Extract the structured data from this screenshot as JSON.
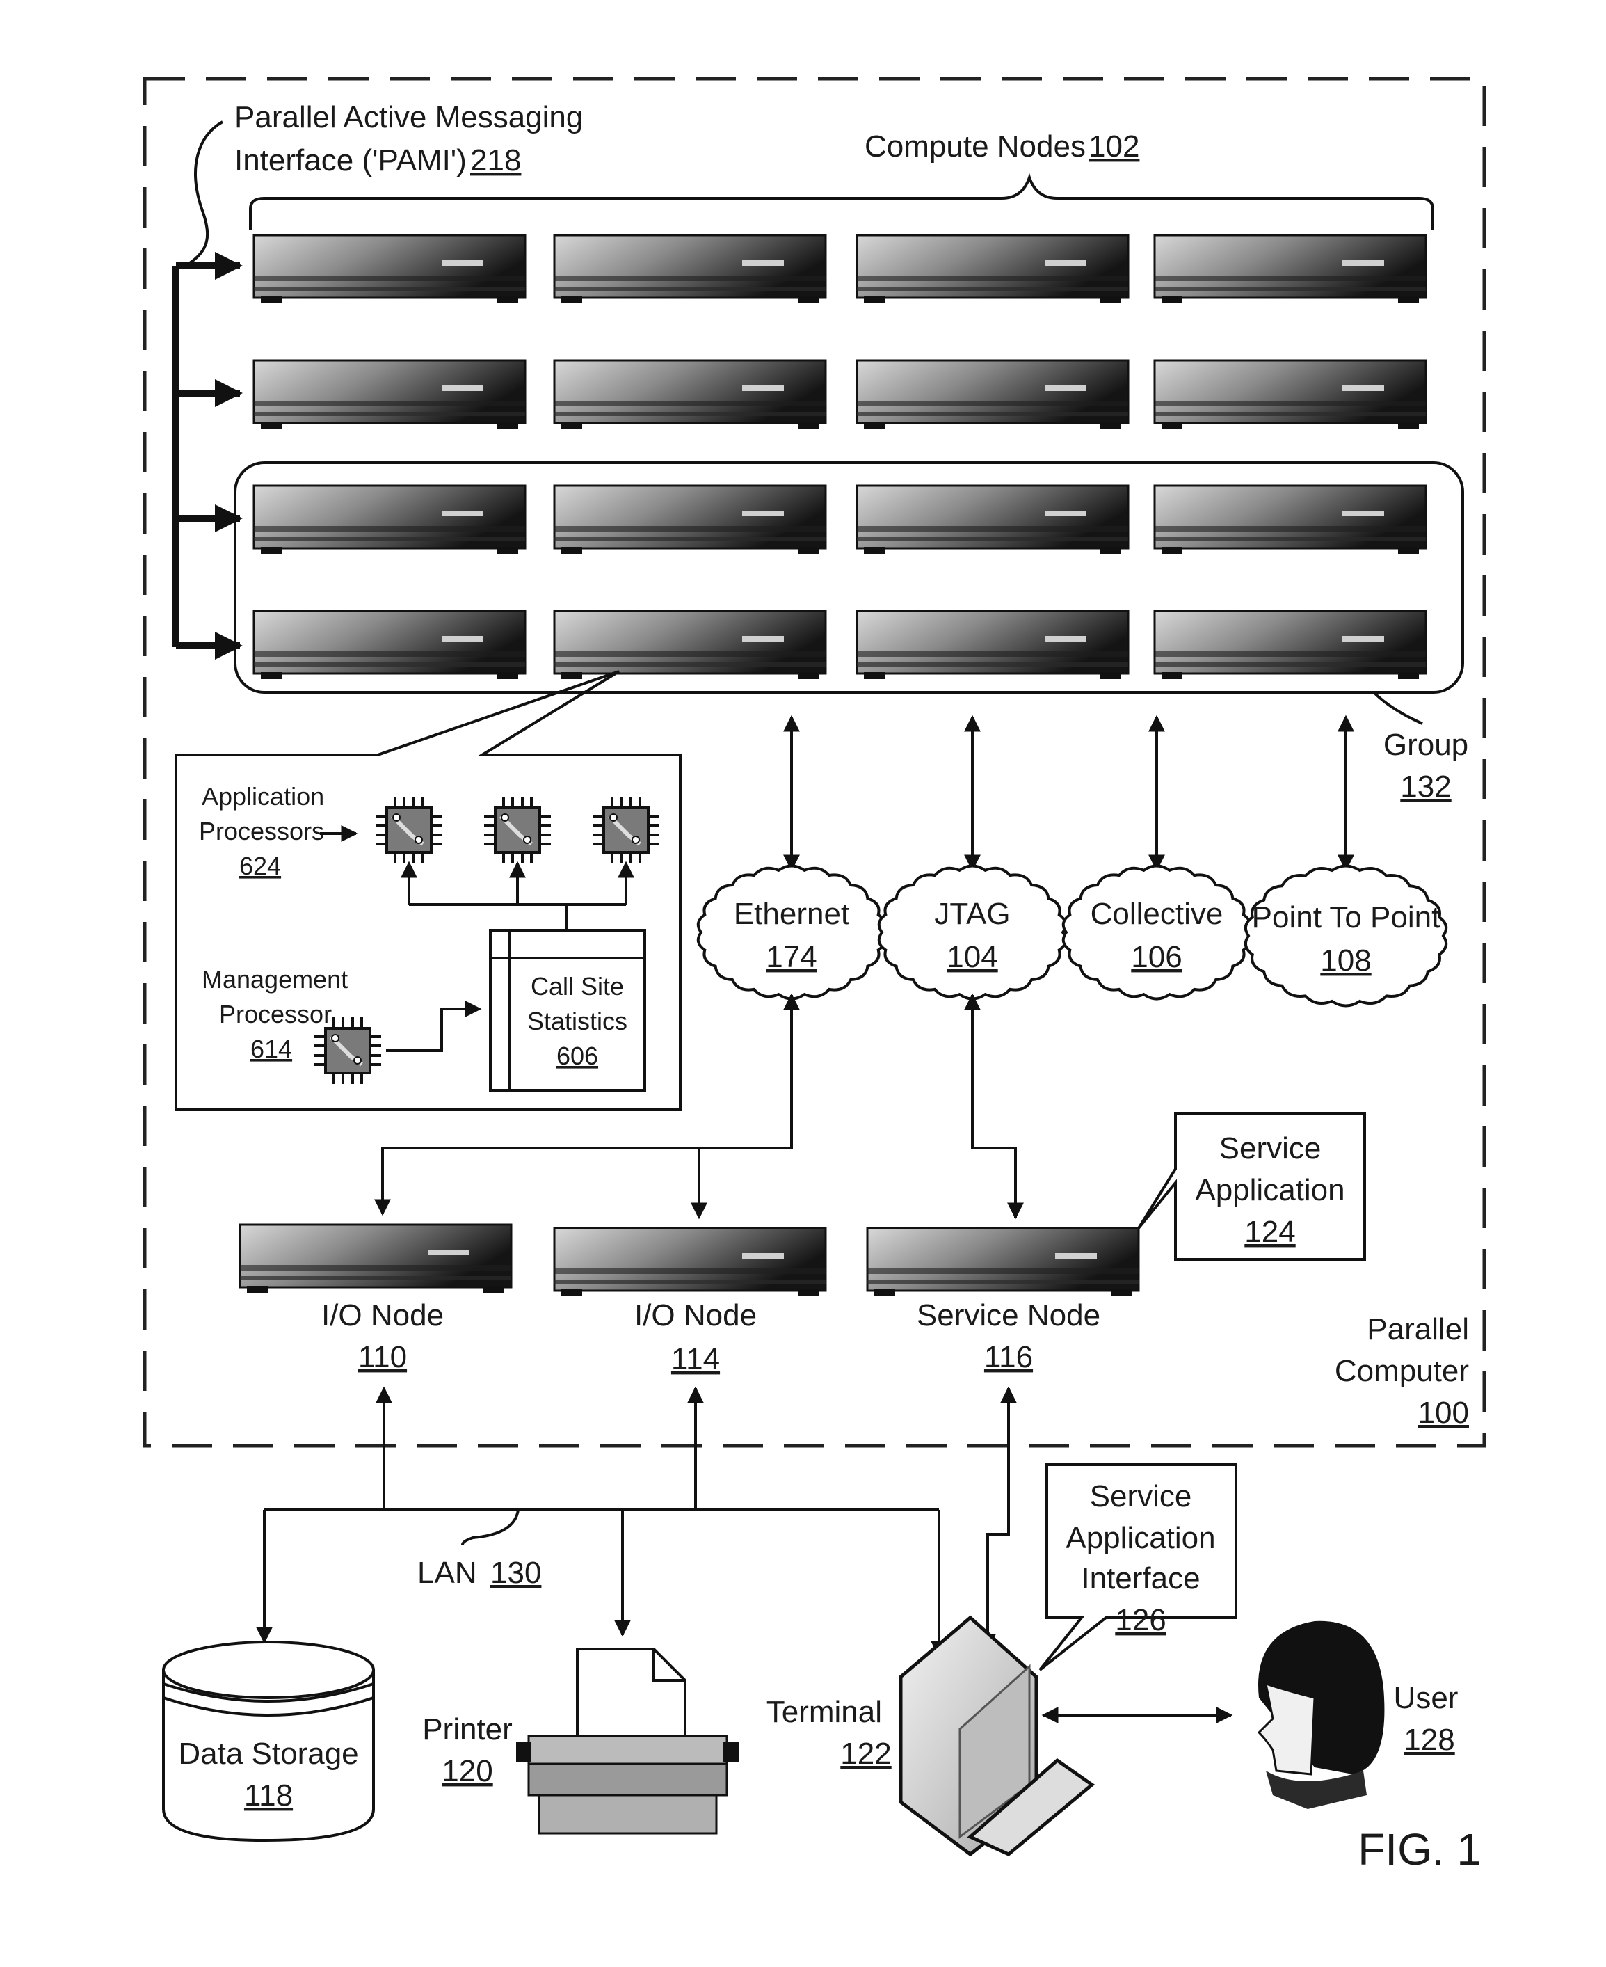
{
  "figure": {
    "label": "FIG. 1",
    "parallel_computer": {
      "name_line1": "Parallel",
      "name_line2": "Computer",
      "ref": "100"
    },
    "pami": {
      "line1": "Parallel Active Messaging",
      "line2": "Interface ('PAMI')",
      "ref": "218"
    },
    "compute_nodes": {
      "label": "Compute Nodes",
      "ref": "102",
      "rows": 4,
      "cols": 4
    },
    "group": {
      "label": "Group",
      "ref": "132"
    },
    "inset": {
      "app_processors": {
        "line1": "Application",
        "line2": "Processors",
        "ref": "624"
      },
      "mgmt_processor": {
        "line1": "Management",
        "line2": "Processor",
        "ref": "614"
      },
      "call_site_stats": {
        "line1": "Call Site",
        "line2": "Statistics",
        "ref": "606"
      }
    },
    "networks": [
      {
        "label": "Ethernet",
        "ref": "174"
      },
      {
        "label": "JTAG",
        "ref": "104"
      },
      {
        "label": "Collective",
        "ref": "106"
      },
      {
        "label": "Point To Point",
        "ref": "108"
      }
    ],
    "io_nodes": [
      {
        "label": "I/O Node",
        "ref": "110"
      },
      {
        "label": "I/O Node",
        "ref": "114"
      }
    ],
    "service_node": {
      "label": "Service Node",
      "ref": "116"
    },
    "service_application": {
      "line1": "Service",
      "line2": "Application",
      "ref": "124"
    },
    "lan": {
      "label": "LAN",
      "ref": "130"
    },
    "data_storage": {
      "label": "Data Storage",
      "ref": "118"
    },
    "printer": {
      "label": "Printer",
      "ref": "120"
    },
    "terminal": {
      "label": "Terminal",
      "ref": "122"
    },
    "service_app_interface": {
      "line1": "Service",
      "line2": "Application",
      "line3": "Interface",
      "ref": "126"
    },
    "user": {
      "label": "User",
      "ref": "128"
    }
  }
}
